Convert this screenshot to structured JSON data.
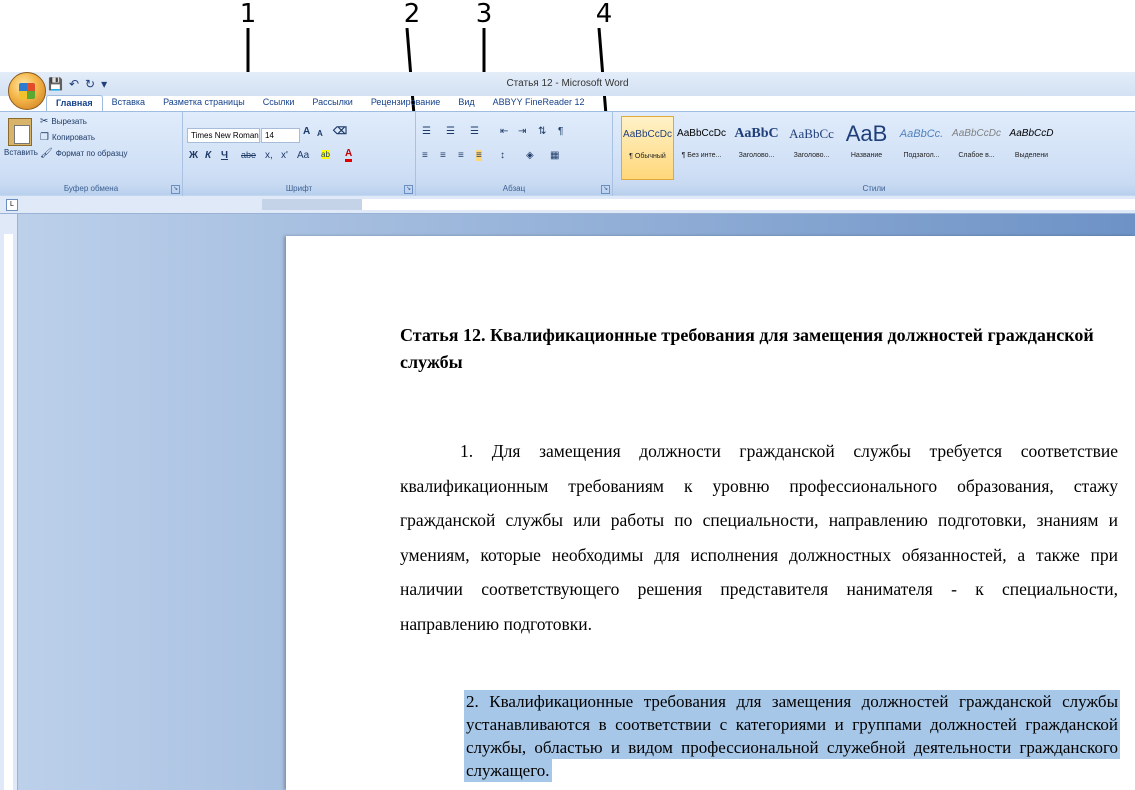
{
  "annotations": [
    "1",
    "2",
    "3",
    "4"
  ],
  "window": {
    "title": "Статья 12 - Microsoft Word"
  },
  "tabs": [
    "Главная",
    "Вставка",
    "Разметка страницы",
    "Ссылки",
    "Рассылки",
    "Рецензирование",
    "Вид",
    "ABBYY FineReader 12"
  ],
  "active_tab": "Главная",
  "clipboard": {
    "paste": "Вставить",
    "cut": "Вырезать",
    "copy": "Копировать",
    "format_painter": "Формат по образцу",
    "group": "Буфер обмена"
  },
  "font": {
    "name": "Times New Roman",
    "size": "14",
    "grow": "A",
    "shrink": "A",
    "bold": "Ж",
    "italic": "К",
    "underline": "Ч",
    "strike": "abe",
    "subscript": "x,",
    "superscript": "x'",
    "case": "Aa",
    "highlight": "ab",
    "color": "A",
    "group": "Шрифт"
  },
  "paragraph": {
    "group": "Абзац"
  },
  "styles": {
    "group": "Стили",
    "items": [
      {
        "sample": "AaBbCcDc",
        "name": "¶ Обычный"
      },
      {
        "sample": "AaBbCcDc",
        "name": "¶ Без инте..."
      },
      {
        "sample": "AaBbC",
        "name": "Заголово..."
      },
      {
        "sample": "AaBbCc",
        "name": "Заголово..."
      },
      {
        "sample": "AaB",
        "name": "Название"
      },
      {
        "sample": "AaBbCc.",
        "name": "Подзагол..."
      },
      {
        "sample": "AaBbCcDc",
        "name": "Слабое в..."
      },
      {
        "sample": "AaBbCcD",
        "name": "Выделени"
      }
    ]
  },
  "document": {
    "title": "Статья 12. Квалификационные требования для замещения должностей гражданской службы",
    "para1": "1. Для замещения должности гражданской службы требуется соответствие квалификационным требованиям к уровню профессионального образования, стажу гражданской службы или работы по специальности, направлению подготовки, знаниям и умениям, которые необходимы для исполнения должностных обязанностей, а также при наличии соответствующего решения представителя нанимателя - к специальности, направлению подготовки.",
    "para2": "2. Квалификационные требования для замещения должностей гражданской службы устанавливаются в соответствии с категориями и группами должностей гражданской службы, областью и видом профессиональной служебной деятельности гражданского служащего."
  }
}
